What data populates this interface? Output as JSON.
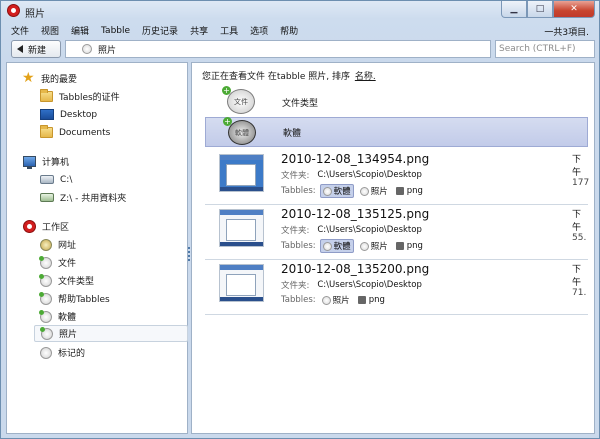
{
  "window": {
    "title": "照片"
  },
  "menu": [
    "文件",
    "视图",
    "编辑",
    "Tabble",
    "历史记录",
    "共享",
    "工具",
    "选项",
    "帮助"
  ],
  "status": {
    "count_text": "一共3項目."
  },
  "toolbar": {
    "new_label": "新建",
    "path_label": "照片",
    "search_placeholder": "Search (CTRL+F)"
  },
  "sidebar": {
    "favorites": {
      "title": "我的最愛",
      "items": [
        {
          "label": "Tabbles的证件",
          "icon": "folder-icon"
        },
        {
          "label": "Desktop",
          "icon": "desktop-icon"
        },
        {
          "label": "Documents",
          "icon": "folder-icon"
        }
      ]
    },
    "computer": {
      "title": "计算机",
      "items": [
        {
          "label": "C:\\",
          "icon": "drive-icon"
        },
        {
          "label": "Z:\\ - 共用資料夾",
          "icon": "network-drive-icon"
        }
      ]
    },
    "workspace": {
      "title": "工作区",
      "items": [
        {
          "label": "网址",
          "icon": "globe-icon"
        },
        {
          "label": "文件",
          "icon": "tabble-icon"
        },
        {
          "label": "文件类型",
          "icon": "tabble-icon"
        },
        {
          "label": "帮助Tabbles",
          "icon": "tabble-icon"
        },
        {
          "label": "軟體",
          "icon": "tabble-icon"
        },
        {
          "label": "照片",
          "icon": "tabble-icon",
          "selected": true
        },
        {
          "label": "标记的",
          "icon": "tabble-icon"
        }
      ]
    }
  },
  "main": {
    "info_prefix": "您正在查看文件 在tabble 照片, 排序",
    "sort_link": "名称.",
    "groups": [
      {
        "label": "文件类型",
        "icon_text": "文件"
      },
      {
        "label": "軟體",
        "icon_text": "軟體",
        "selected": true
      }
    ],
    "field_labels": {
      "folder": "文件夹:",
      "tabbles": "Tabbles:"
    },
    "files": [
      {
        "name": "2010-12-08_134954.png",
        "folder": "C:\\Users\\Scopio\\Desktop",
        "tabbles": [
          {
            "label": "軟體",
            "highlight": true
          },
          {
            "label": "照片",
            "highlight": false
          }
        ],
        "type": "png",
        "date": "下午",
        "size": "177"
      },
      {
        "name": "2010-12-08_135125.png",
        "folder": "C:\\Users\\Scopio\\Desktop",
        "tabbles": [
          {
            "label": "軟體",
            "highlight": true
          },
          {
            "label": "照片",
            "highlight": false
          }
        ],
        "type": "png",
        "date": "下午",
        "size": "55."
      },
      {
        "name": "2010-12-08_135200.png",
        "folder": "C:\\Users\\Scopio\\Desktop",
        "tabbles": [
          {
            "label": "照片",
            "highlight": false
          }
        ],
        "type": "png",
        "date": "下午",
        "size": "71."
      }
    ]
  },
  "colors": {
    "accent": "#c2cbe9",
    "brand": "#d21e1e",
    "window_bg": "#cddcee"
  }
}
